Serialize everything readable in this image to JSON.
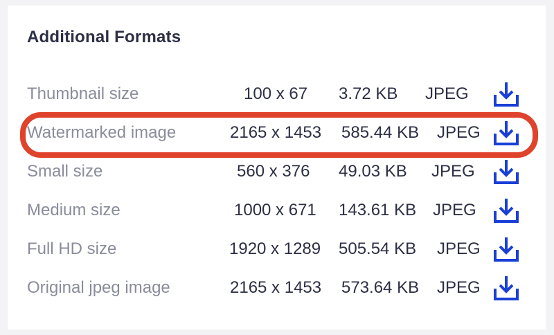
{
  "panel": {
    "title": "Additional Formats"
  },
  "formats": [
    {
      "name": "Thumbnail size",
      "dimensions": "100 x 67",
      "size": "3.72 KB",
      "format": "JPEG",
      "highlighted": false,
      "icon": "download-icon"
    },
    {
      "name": "Watermarked image",
      "dimensions": "2165 x 1453",
      "size": "585.44 KB",
      "format": "JPEG",
      "highlighted": true,
      "icon": "download-icon"
    },
    {
      "name": "Small size",
      "dimensions": "560 x 376",
      "size": "49.03 KB",
      "format": "JPEG",
      "highlighted": false,
      "icon": "download-icon"
    },
    {
      "name": "Medium size",
      "dimensions": "1000 x 671",
      "size": "143.61 KB",
      "format": "JPEG",
      "highlighted": false,
      "icon": "download-icon"
    },
    {
      "name": "Full HD size",
      "dimensions": "1920 x 1289",
      "size": "505.54 KB",
      "format": "JPEG",
      "highlighted": false,
      "icon": "download-icon"
    },
    {
      "name": "Original jpeg image",
      "dimensions": "2165 x 1453",
      "size": "573.64 KB",
      "format": "JPEG",
      "highlighted": false,
      "icon": "download-icon"
    }
  ],
  "colors": {
    "title": "#2d2f45",
    "label": "#8a8c9b",
    "value": "#2d2f45",
    "icon": "#1a3fd6",
    "highlight": "#e0432b"
  }
}
